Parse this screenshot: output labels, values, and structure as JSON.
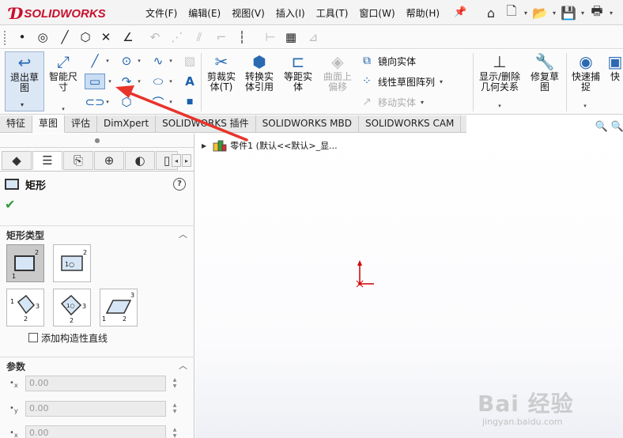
{
  "app": {
    "ds_mark": "Ɗ",
    "brand": "SOLIDWORKS"
  },
  "menu": [
    "文件(F)",
    "编辑(E)",
    "视图(V)",
    "插入(I)",
    "工具(T)",
    "窗口(W)",
    "帮助(H)"
  ],
  "ribbon": {
    "exit_sketch": "退出草\n图",
    "smart_dim": "智能尺\n寸",
    "trim": "剪裁实\n体(T)",
    "convert": "转换实\n体引用",
    "offset": "等距实\n体",
    "surface_offset": "曲面上\n偏移",
    "mirror": "镜向实体",
    "linear_pattern": "线性草图阵列",
    "move": "移动实体",
    "display_relations": "显示/删除\n几何关系",
    "repair": "修复草\n图",
    "quick_snap": "快速捕\n捉",
    "quick_more": "快"
  },
  "tabs": [
    "特征",
    "草图",
    "评估",
    "DimXpert",
    "SOLIDWORKS 插件",
    "SOLIDWORKS MBD",
    "SOLIDWORKS CAM"
  ],
  "active_tab": 1,
  "property_manager": {
    "title": "矩形",
    "help": "?",
    "section_type": "矩形类型",
    "add_construction": "添加构造性直线",
    "section_params": "参数",
    "params": [
      {
        "label": "x",
        "value": "0.00"
      },
      {
        "label": "y",
        "value": "0.00"
      },
      {
        "label": "x",
        "value": "0.00"
      }
    ]
  },
  "feature_tree": {
    "item": "零件1  (默认<<默认>_显..."
  },
  "watermark": {
    "main": "Bai 经验",
    "sub": "jingyan.baidu.com"
  },
  "colors": {
    "brand": "#c8102e",
    "accent": "#2b6ab3",
    "annotation": "#e8332b"
  }
}
